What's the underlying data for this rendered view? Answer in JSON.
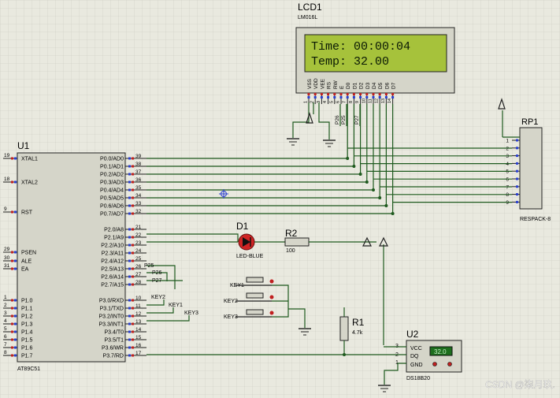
{
  "lcd": {
    "ref": "LCD1",
    "model": "LM016L",
    "line1": "Time: 00:00:04",
    "line2": "Temp: 32.00",
    "pin_labels": [
      "VSS",
      "VDD",
      "VEE",
      "RS",
      "RW",
      "E",
      "D0",
      "D1",
      "D2",
      "D3",
      "D4",
      "D5",
      "D6",
      "D7"
    ],
    "pin_numbers": [
      "1",
      "2",
      "3",
      "4",
      "5",
      "6",
      "7",
      "8",
      "9",
      "10",
      "11",
      "12",
      "13",
      "14"
    ],
    "net_labels": [
      "P26",
      "P25",
      "P27"
    ]
  },
  "mcu": {
    "ref": "U1",
    "model": "AT89C51",
    "left_pins": [
      {
        "num": "19",
        "name": "XTAL1"
      },
      {
        "num": "18",
        "name": "XTAL2"
      },
      {
        "num": "9",
        "name": "RST"
      },
      {
        "num": "29",
        "name": "PSEN"
      },
      {
        "num": "30",
        "name": "ALE"
      },
      {
        "num": "31",
        "name": "EA"
      },
      {
        "num": "1",
        "name": "P1.0"
      },
      {
        "num": "2",
        "name": "P1.1"
      },
      {
        "num": "3",
        "name": "P1.2"
      },
      {
        "num": "4",
        "name": "P1.3"
      },
      {
        "num": "5",
        "name": "P1.4"
      },
      {
        "num": "6",
        "name": "P1.5"
      },
      {
        "num": "7",
        "name": "P1.6"
      },
      {
        "num": "8",
        "name": "P1.7"
      }
    ],
    "right_pins": [
      {
        "num": "39",
        "name": "P0.0/AD0"
      },
      {
        "num": "38",
        "name": "P0.1/AD1"
      },
      {
        "num": "37",
        "name": "P0.2/AD2"
      },
      {
        "num": "36",
        "name": "P0.3/AD3"
      },
      {
        "num": "35",
        "name": "P0.4/AD4"
      },
      {
        "num": "34",
        "name": "P0.5/AD5"
      },
      {
        "num": "33",
        "name": "P0.6/AD6"
      },
      {
        "num": "32",
        "name": "P0.7/AD7"
      },
      {
        "num": "21",
        "name": "P2.0/A8"
      },
      {
        "num": "22",
        "name": "P2.1/A9"
      },
      {
        "num": "23",
        "name": "P2.2/A10"
      },
      {
        "num": "24",
        "name": "P2.3/A11"
      },
      {
        "num": "25",
        "name": "P2.4/A12"
      },
      {
        "num": "26",
        "name": "P2.5/A13"
      },
      {
        "num": "27",
        "name": "P2.6/A14"
      },
      {
        "num": "28",
        "name": "P2.7/A15"
      },
      {
        "num": "10",
        "name": "P3.0/RXD"
      },
      {
        "num": "11",
        "name": "P3.1/TXD"
      },
      {
        "num": "12",
        "name": "P3.2/INT0"
      },
      {
        "num": "13",
        "name": "P3.3/INT1"
      },
      {
        "num": "14",
        "name": "P3.4/T0"
      },
      {
        "num": "15",
        "name": "P3.5/T1"
      },
      {
        "num": "16",
        "name": "P3.6/WR"
      },
      {
        "num": "17",
        "name": "P3.7/RD"
      }
    ],
    "net_labels": [
      "P25",
      "P26",
      "P27",
      "KEY2",
      "KEY1",
      "KEY3"
    ]
  },
  "rp1": {
    "ref": "RP1",
    "model": "RESPACK-8",
    "pin_numbers": [
      "1",
      "2",
      "3",
      "4",
      "5",
      "6",
      "7",
      "8",
      "9"
    ]
  },
  "d1": {
    "ref": "D1",
    "model": "LED-BLUE"
  },
  "r2": {
    "ref": "R2",
    "value": "100"
  },
  "r1": {
    "ref": "R1",
    "value": "4.7k"
  },
  "keys": [
    "KEY1",
    "KEY2",
    "KEY3"
  ],
  "u2": {
    "ref": "U2",
    "model": "DS18B20",
    "pins": [
      {
        "num": "3",
        "name": "VCC"
      },
      {
        "num": "2",
        "name": "DQ"
      },
      {
        "num": "1",
        "name": "GND"
      }
    ],
    "reading": "32.0"
  },
  "watermark": "CSDN @柒月玖."
}
